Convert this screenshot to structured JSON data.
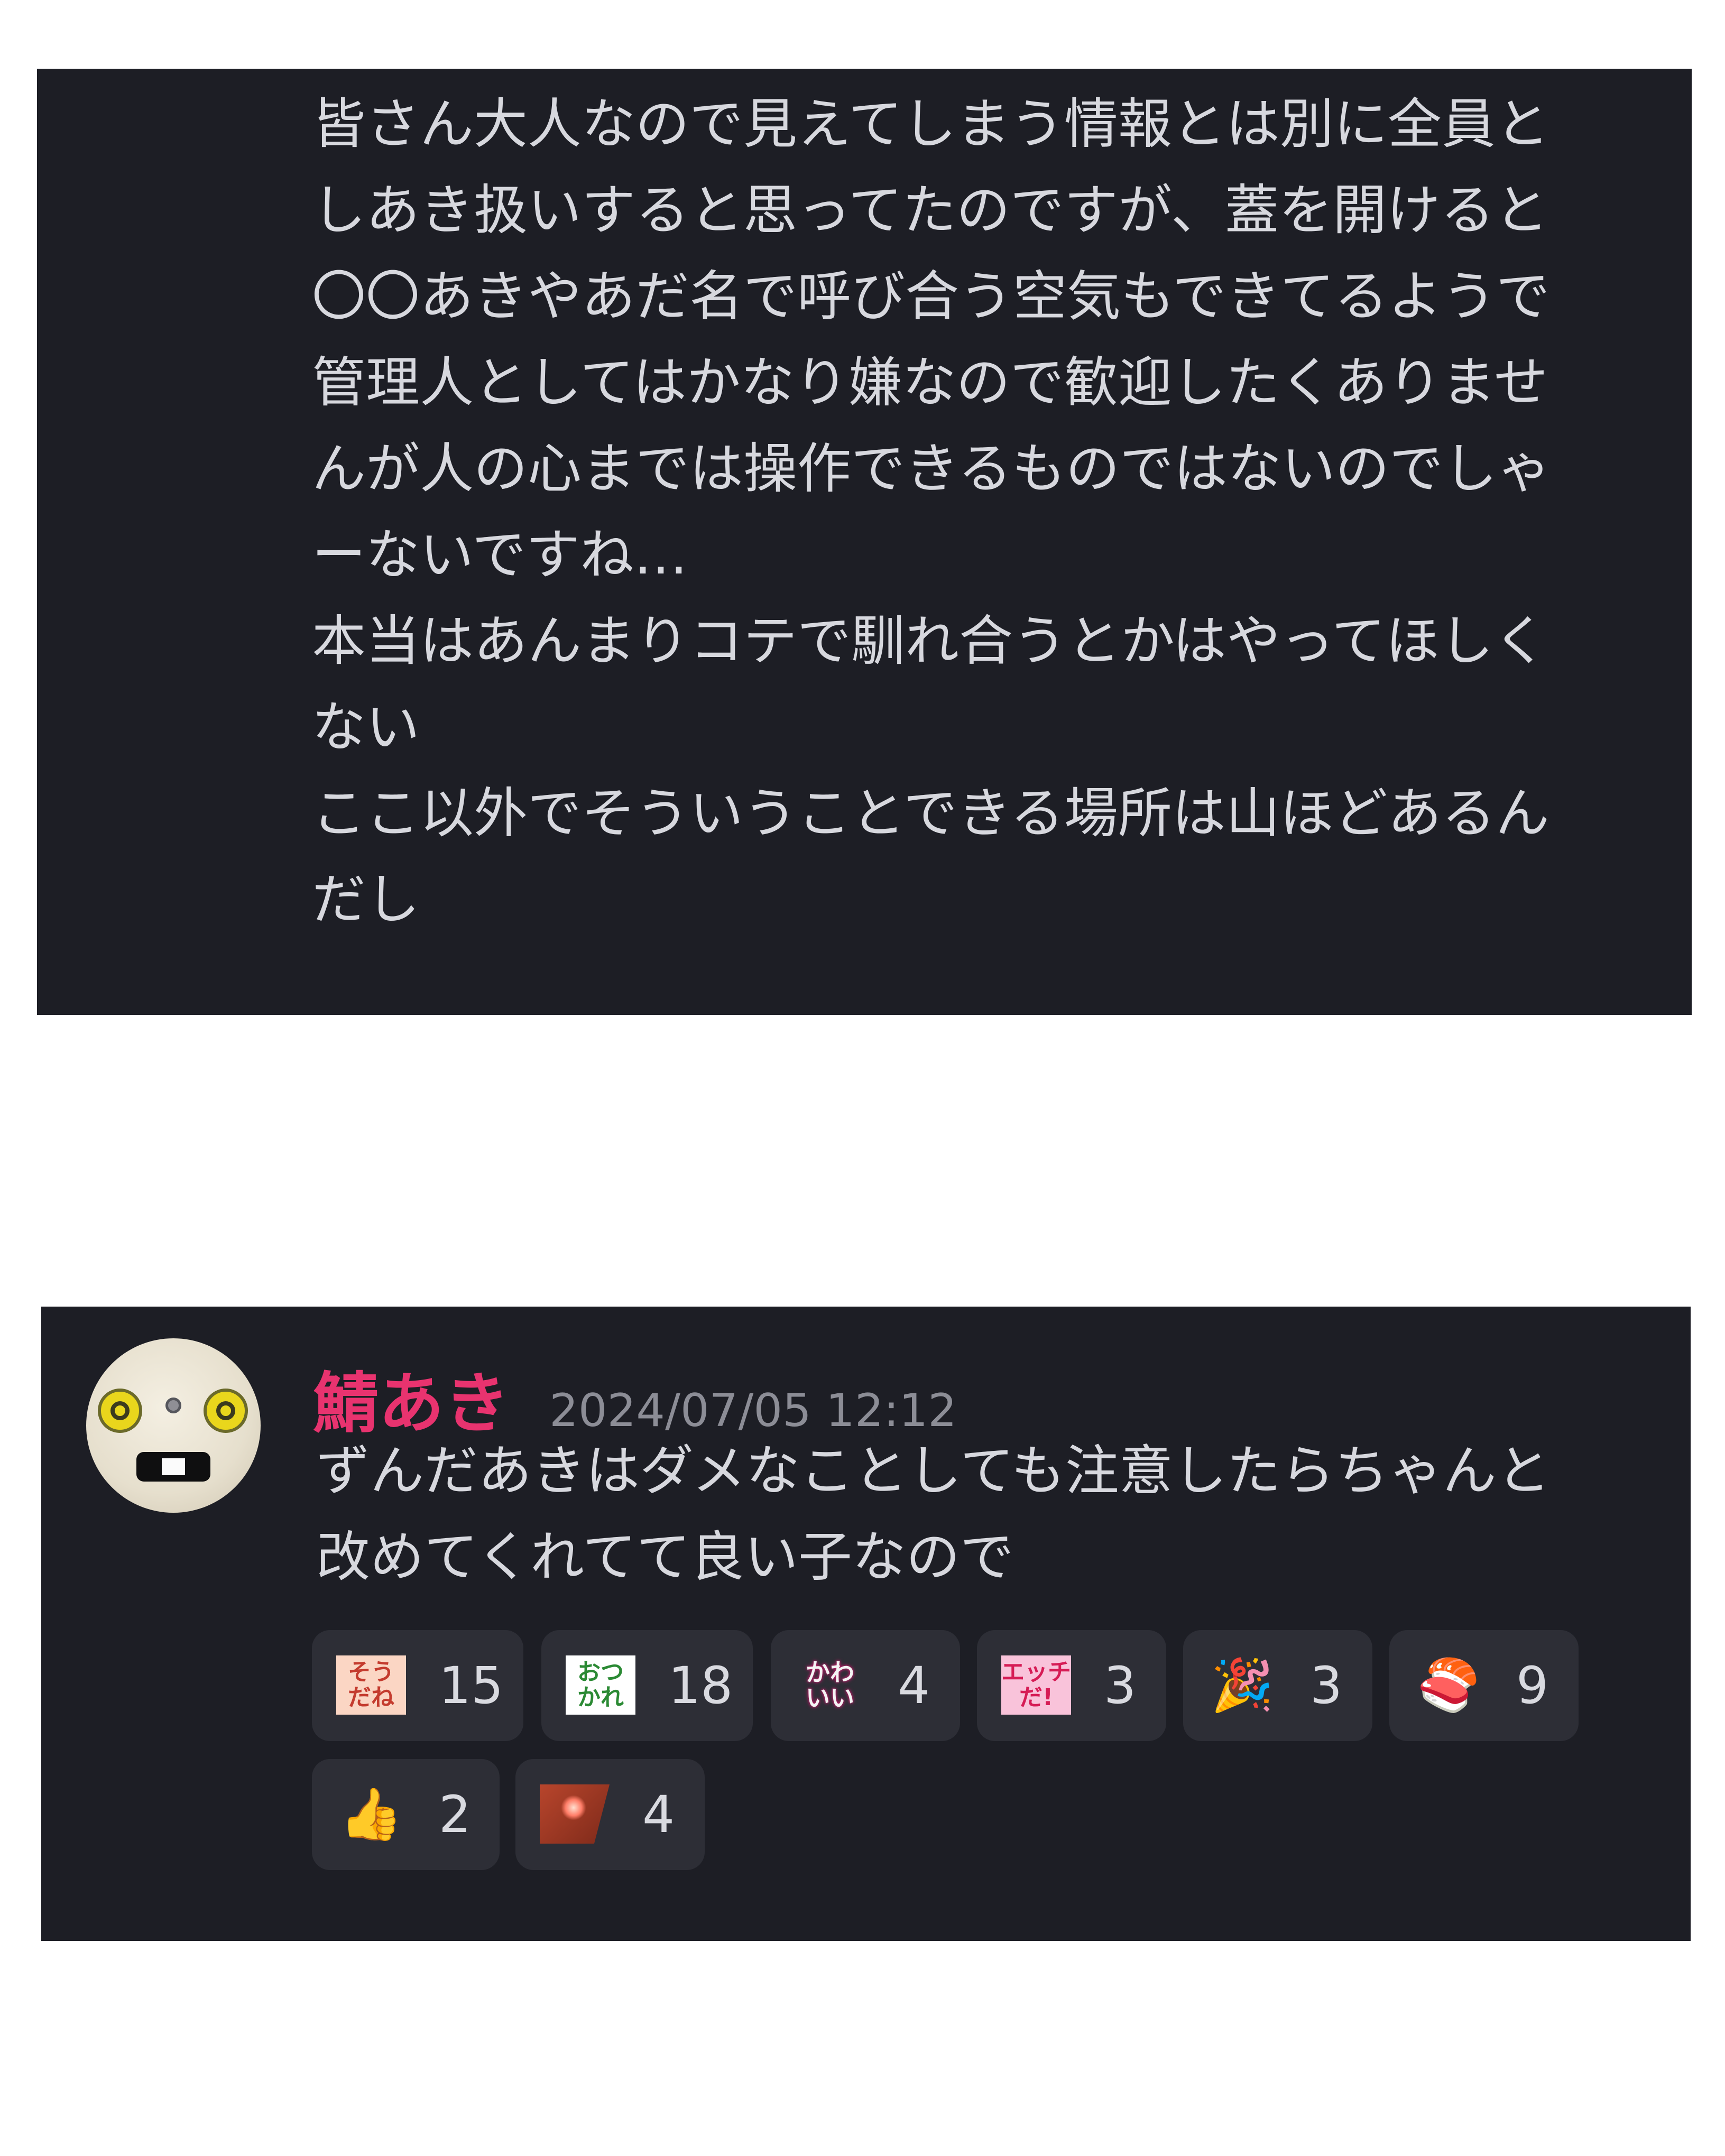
{
  "top_message": {
    "lines": [
      "皆さん大人なので見えてしまう情報とは別に全員と",
      "しあき扱いすると思ってたのですが、蓋を開けると",
      "〇〇あきやあだ名で呼び合う空気もできてるようで",
      "管理人としてはかなり嫌なので歓迎したくありませ",
      "んが人の心までは操作できるものではないのでしゃ",
      "ーないですね…",
      "本当はあんまりコテで馴れ合うとかはやってほしく",
      "ない",
      "ここ以外でそういうことできる場所は山ほどあるん",
      "だし"
    ]
  },
  "bottom_message": {
    "author": "鯖あき",
    "timestamp": "2024/07/05 12:12",
    "lines": [
      "ずんだあきはダメなことしても注意したらちゃんと",
      "改めてくれてて良い子なので"
    ],
    "reactions": [
      {
        "icon": "souda-sticker",
        "label": "そう\nだね",
        "count": "15"
      },
      {
        "icon": "otsukare-sticker",
        "label": "おつ\nかれ",
        "count": "18"
      },
      {
        "icon": "kawaii-sticker",
        "label": "かわ\nいい",
        "count": "4"
      },
      {
        "icon": "ecchi-sticker",
        "label": "エッチ\nだ!",
        "count": "3"
      },
      {
        "icon": "party-popper-emoji",
        "label": "🎉",
        "count": "3"
      },
      {
        "icon": "sushi-emoji",
        "label": "🍣",
        "count": "9"
      },
      {
        "icon": "thumbs-up-emoji",
        "label": "👍",
        "count": "2"
      },
      {
        "icon": "firework-sticker",
        "label": "",
        "count": "4"
      }
    ]
  },
  "colors": {
    "panel_background": "#1d1e25",
    "text": "#d7d8de",
    "author": "#e8336f",
    "timestamp": "#8c8d96",
    "reaction_background": "#2d2e36"
  }
}
